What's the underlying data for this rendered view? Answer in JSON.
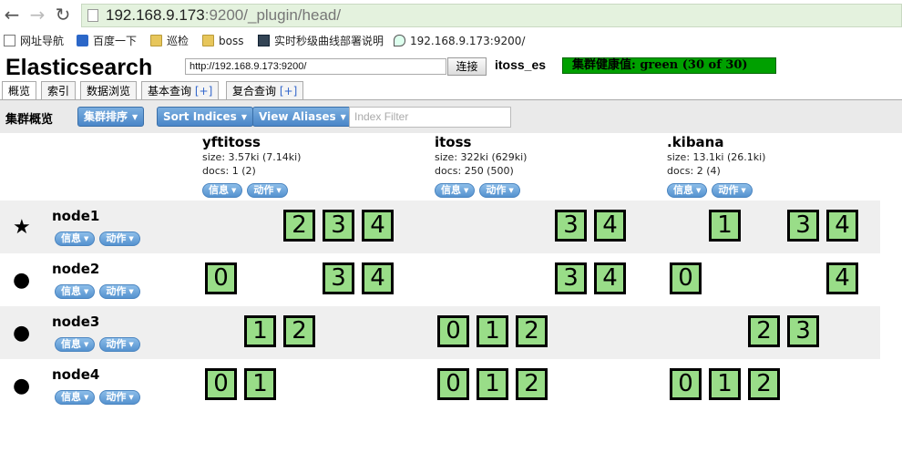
{
  "browser": {
    "url_host": "192.168.9.173",
    "url_rest": ":9200/_plugin/head/",
    "bookmarks": [
      {
        "label": "网址导航",
        "icon": "page-icon"
      },
      {
        "label": "百度一下",
        "icon": "paw-icon"
      },
      {
        "label": "巡检",
        "icon": "folder-icon"
      },
      {
        "label": "boss",
        "icon": "folder-icon"
      },
      {
        "label": "实时秒级曲线部署说明",
        "icon": "chart-icon"
      },
      {
        "label": "192.168.9.173:9200/",
        "icon": "leaf-icon"
      }
    ]
  },
  "header": {
    "brand": "Elasticsearch",
    "connect_url": "http://192.168.9.173:9200/",
    "connect_label": "连接",
    "cluster_name": "itoss_es",
    "health": "集群健康值: green (30 of 30)",
    "health_color": "#00a000"
  },
  "tabs": [
    {
      "label": "概览",
      "plus": ""
    },
    {
      "label": "索引",
      "plus": ""
    },
    {
      "label": "数据浏览",
      "plus": ""
    },
    {
      "label": "基本查询",
      "plus": "[+]"
    },
    {
      "label": "复合查询",
      "plus": "[+]"
    }
  ],
  "toolbar": {
    "title": "集群概览",
    "sort_cluster": "集群排序",
    "sort_indices": "Sort Indices",
    "view_aliases": "View Aliases",
    "filter_placeholder": "Index Filter"
  },
  "pill_labels": {
    "info": "信息",
    "action": "动作"
  },
  "indices": [
    {
      "name": "yftitoss",
      "size": "size: 3.57ki (7.14ki)",
      "docs": "docs: 1 (2)"
    },
    {
      "name": "itoss",
      "size": "size: 322ki (629ki)",
      "docs": "docs: 250 (500)"
    },
    {
      "name": ".kibana",
      "size": "size: 13.1ki (26.1ki)",
      "docs": "docs: 2 (4)"
    }
  ],
  "nodes": [
    {
      "name": "node1",
      "master": true,
      "shards": [
        [
          "",
          "",
          "2",
          "3",
          "4"
        ],
        [
          "",
          "",
          "",
          "3",
          "4"
        ],
        [
          "",
          "1",
          "",
          "3",
          "4"
        ]
      ]
    },
    {
      "name": "node2",
      "master": false,
      "shards": [
        [
          "0",
          "",
          "",
          "3",
          "4"
        ],
        [
          "",
          "",
          "",
          "3",
          "4"
        ],
        [
          "0",
          "",
          "",
          "",
          "4"
        ]
      ]
    },
    {
      "name": "node3",
      "master": false,
      "shards": [
        [
          "",
          "1",
          "2",
          "",
          ""
        ],
        [
          "0",
          "1",
          "2",
          "",
          ""
        ],
        [
          "",
          "",
          "2",
          "3",
          ""
        ]
      ]
    },
    {
      "name": "node4",
      "master": false,
      "shards": [
        [
          "0",
          "1",
          "",
          "",
          ""
        ],
        [
          "0",
          "1",
          "2",
          "",
          ""
        ],
        [
          "0",
          "1",
          "2",
          "",
          ""
        ]
      ]
    }
  ],
  "colors": {
    "shard_fill": "#99dd88",
    "dropdown_blue": "#4a86c8"
  }
}
